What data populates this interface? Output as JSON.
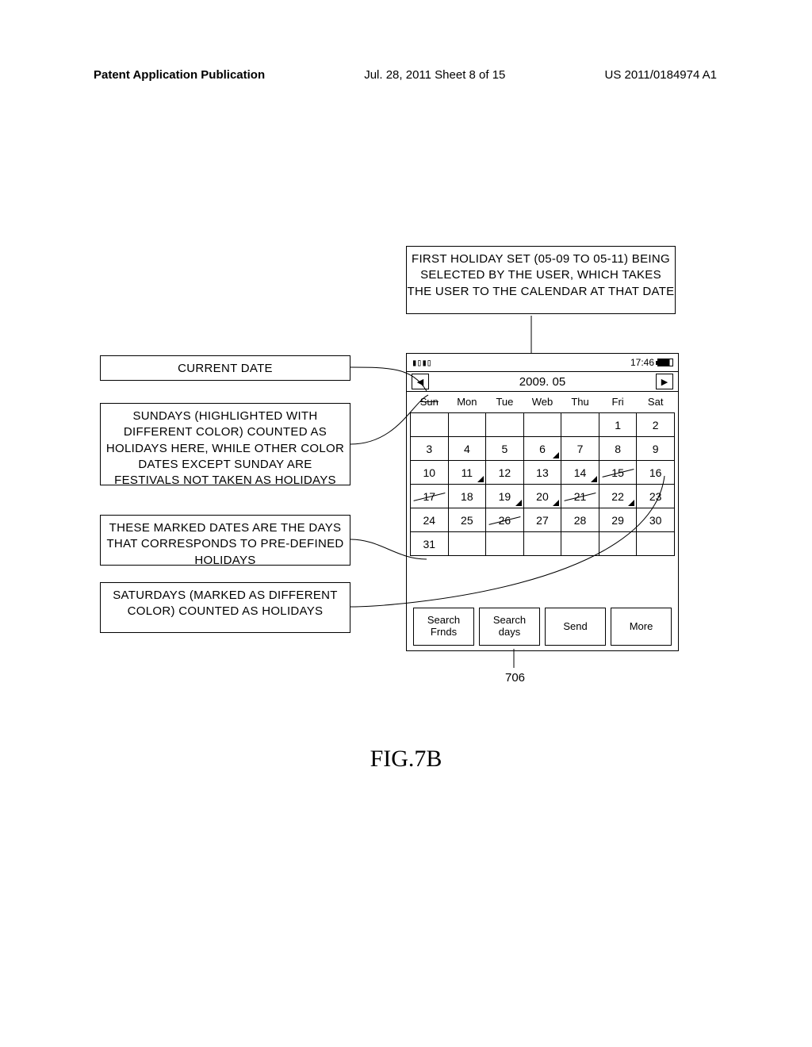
{
  "header": {
    "left": "Patent Application Publication",
    "mid": "Jul. 28, 2011  Sheet 8 of 15",
    "right": "US 2011/0184974 A1"
  },
  "top_box": "FIRST HOLIDAY SET (05-09 TO 05-11) BEING SELECTED BY THE USER, WHICH TAKES THE USER TO THE CALENDAR AT THAT DATE",
  "box1": "CURRENT DATE",
  "box2": "SUNDAYS (HIGHLIGHTED WITH DIFFERENT COLOR) COUNTED AS HOLIDAYS HERE, WHILE OTHER COLOR DATES EXCEPT SUNDAY ARE FESTIVALS NOT TAKEN AS HOLIDAYS",
  "box3": "THESE MARKED DATES ARE THE DAYS THAT CORRESPONDS TO PRE-DEFINED HOLIDAYS",
  "box4": "SATURDAYS (MARKED AS DIFFERENT COLOR) COUNTED AS HOLIDAYS",
  "phone": {
    "time": "17:46",
    "month": "2009. 05",
    "weekdays": [
      "Sun",
      "Mon",
      "Tue",
      "Web",
      "Thu",
      "Fri",
      "Sat"
    ],
    "softkeys": [
      "Search Frnds",
      "Search days",
      "Send",
      "More"
    ]
  },
  "cal_rows": [
    [
      {
        "v": "",
        "e": 1
      },
      {
        "v": "",
        "e": 1
      },
      {
        "v": "",
        "e": 1
      },
      {
        "v": "",
        "e": 1
      },
      {
        "v": "",
        "e": 1
      },
      {
        "v": "1"
      },
      {
        "v": "2"
      }
    ],
    [
      {
        "v": "3"
      },
      {
        "v": "4"
      },
      {
        "v": "5"
      },
      {
        "v": "6",
        "m": 1
      },
      {
        "v": "7"
      },
      {
        "v": "8"
      },
      {
        "v": "9"
      }
    ],
    [
      {
        "v": "10"
      },
      {
        "v": "11",
        "m": 1
      },
      {
        "v": "12"
      },
      {
        "v": "13"
      },
      {
        "v": "14",
        "m": 1
      },
      {
        "v": "15",
        "s": 1
      },
      {
        "v": "16"
      }
    ],
    [
      {
        "v": "17",
        "s": 1
      },
      {
        "v": "18"
      },
      {
        "v": "19",
        "m": 1
      },
      {
        "v": "20",
        "m": 1
      },
      {
        "v": "21",
        "s": 1
      },
      {
        "v": "22",
        "m": 1
      },
      {
        "v": "23"
      }
    ],
    [
      {
        "v": "24"
      },
      {
        "v": "25"
      },
      {
        "v": "26",
        "s": 1
      },
      {
        "v": "27"
      },
      {
        "v": "28"
      },
      {
        "v": "29"
      },
      {
        "v": "30"
      }
    ],
    [
      {
        "v": "31"
      },
      {
        "v": "",
        "e": 1
      },
      {
        "v": "",
        "e": 1
      },
      {
        "v": "",
        "e": 1
      },
      {
        "v": "",
        "e": 1
      },
      {
        "v": "",
        "e": 1
      },
      {
        "v": "",
        "e": 1
      }
    ]
  ],
  "ref_706": "706",
  "figure_caption": "FIG.7B"
}
